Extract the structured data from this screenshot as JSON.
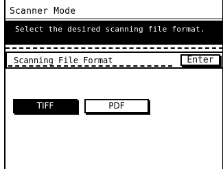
{
  "screen": {
    "title": "Scanner Mode"
  },
  "message": {
    "text": "Select the desired scanning file format."
  },
  "file_format": {
    "label": "Scanning File Format",
    "enter_label": "Enter",
    "options": [
      {
        "label": "TIFF",
        "selected": true
      },
      {
        "label": "PDF",
        "selected": false
      }
    ]
  }
}
